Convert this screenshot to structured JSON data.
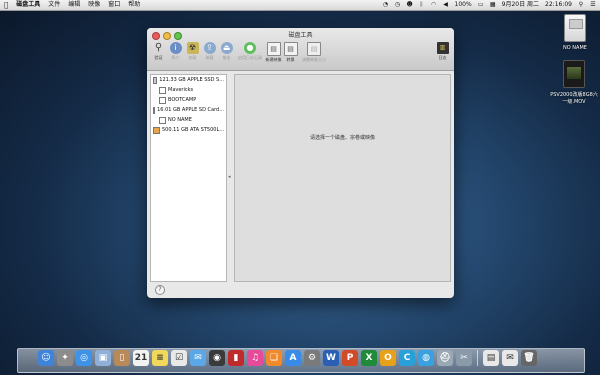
{
  "menubar": {
    "apple": "",
    "app_name": "磁盘工具",
    "menus": [
      "文件",
      "编辑",
      "映像",
      "窗口",
      "帮助"
    ],
    "status": {
      "battery": "100%",
      "date": "9月20日 周二",
      "time": "22:16:09"
    }
  },
  "desktop_icons": [
    {
      "label": "NO NAME"
    },
    {
      "label": "PSV2000改版8G8六一级.MOV"
    }
  ],
  "window": {
    "title": "磁盘工具",
    "toolbar": [
      {
        "label": "验证",
        "icon": "microscope-icon",
        "glyph": "⚲",
        "cls": "ic-micro",
        "disabled": false
      },
      {
        "label": "简介",
        "icon": "info-icon",
        "glyph": "i",
        "cls": "ic-info",
        "disabled": true
      },
      {
        "label": "刻录",
        "icon": "burn-icon",
        "glyph": "☢",
        "cls": "ic-burn",
        "disabled": true
      },
      {
        "label": "装载",
        "icon": "mount-icon",
        "glyph": "⇪",
        "cls": "ic-mount",
        "disabled": true
      },
      {
        "label": "推出",
        "icon": "eject-icon",
        "glyph": "⏏",
        "cls": "ic-eject",
        "disabled": true
      },
      {
        "label": "启用日志记录",
        "icon": "journal-icon",
        "glyph": "●",
        "cls": "ic-log",
        "disabled": true,
        "wide": true
      },
      {
        "label": "新建映像",
        "icon": "new-image-icon",
        "glyph": "▤",
        "cls": "ic-doc",
        "disabled": false
      },
      {
        "label": "转换",
        "icon": "convert-image-icon",
        "glyph": "▤",
        "cls": "ic-doc",
        "disabled": false
      },
      {
        "label": "调整映像大小",
        "icon": "resize-image-icon",
        "glyph": "▤",
        "cls": "ic-doc dis",
        "disabled": true,
        "wide": true
      }
    ],
    "log_label": "日志",
    "drives": [
      {
        "name": "121.33 GB APPLE SSD S...",
        "type": "disk",
        "indent": false
      },
      {
        "name": "Mavericks",
        "type": "volume",
        "indent": true
      },
      {
        "name": "BOOTCAMP",
        "type": "volume",
        "indent": true
      },
      {
        "name": "16.01 GB APPLE SD Card...",
        "type": "disk",
        "indent": false
      },
      {
        "name": "NO NAME",
        "type": "volume",
        "indent": true
      },
      {
        "name": "500.11 GB ATA ST500L...",
        "type": "orange",
        "indent": false
      }
    ],
    "placeholder": "请选择一个磁盘、宗卷或映像",
    "help": "?"
  },
  "dock": [
    {
      "name": "finder-icon",
      "bg": "#3f84d8",
      "g": "☺"
    },
    {
      "name": "launchpad-icon",
      "bg": "#8c8c8c",
      "g": "✦"
    },
    {
      "name": "safari-icon",
      "bg": "#3e93e6",
      "g": "◎"
    },
    {
      "name": "preview-icon",
      "bg": "#8fb0d8",
      "g": "▣"
    },
    {
      "name": "contacts-icon",
      "bg": "#b88a5a",
      "g": "▯"
    },
    {
      "name": "calendar-icon",
      "bg": "#f2f2f2",
      "g": "21"
    },
    {
      "name": "notes-icon",
      "bg": "#f0d85a",
      "g": "≡"
    },
    {
      "name": "reminders-icon",
      "bg": "#e9e9e9",
      "g": "☑"
    },
    {
      "name": "messages-icon",
      "bg": "#5aa8e8",
      "g": "✉"
    },
    {
      "name": "facetime-icon",
      "bg": "#3a3a3a",
      "g": "◉"
    },
    {
      "name": "photobooth-icon",
      "bg": "#c02a2a",
      "g": "▮"
    },
    {
      "name": "itunes-icon",
      "bg": "#e84a9a",
      "g": "♫"
    },
    {
      "name": "ibooks-icon",
      "bg": "#f08a2a",
      "g": "❏"
    },
    {
      "name": "appstore-icon",
      "bg": "#3a8ae8",
      "g": "A"
    },
    {
      "name": "preferences-icon",
      "bg": "#7a7a7a",
      "g": "⚙"
    },
    {
      "name": "word-icon",
      "bg": "#2b5fb3",
      "g": "W"
    },
    {
      "name": "powerpoint-icon",
      "bg": "#d24b26",
      "g": "P"
    },
    {
      "name": "excel-icon",
      "bg": "#1f8a3a",
      "g": "X"
    },
    {
      "name": "outlook-icon",
      "bg": "#e8a11a",
      "g": "O"
    },
    {
      "name": "qq-icon",
      "bg": "#2aa0d8",
      "g": "C"
    },
    {
      "name": "browser-icon",
      "bg": "#3aa0e0",
      "g": "◍"
    },
    {
      "name": "disk-utility-icon",
      "bg": "#9aa7b4",
      "g": "⛑"
    },
    {
      "name": "utility-tools-icon",
      "bg": "#8a9aa8",
      "g": "✂"
    },
    {
      "name": "sep",
      "bg": "",
      "g": ""
    },
    {
      "name": "documents-stack-icon",
      "bg": "#e8e8e8",
      "g": "▤"
    },
    {
      "name": "downloads-stack-icon",
      "bg": "#e8e8e8",
      "g": "✉"
    },
    {
      "name": "trash-icon",
      "bg": "#666",
      "g": "🗑"
    }
  ]
}
